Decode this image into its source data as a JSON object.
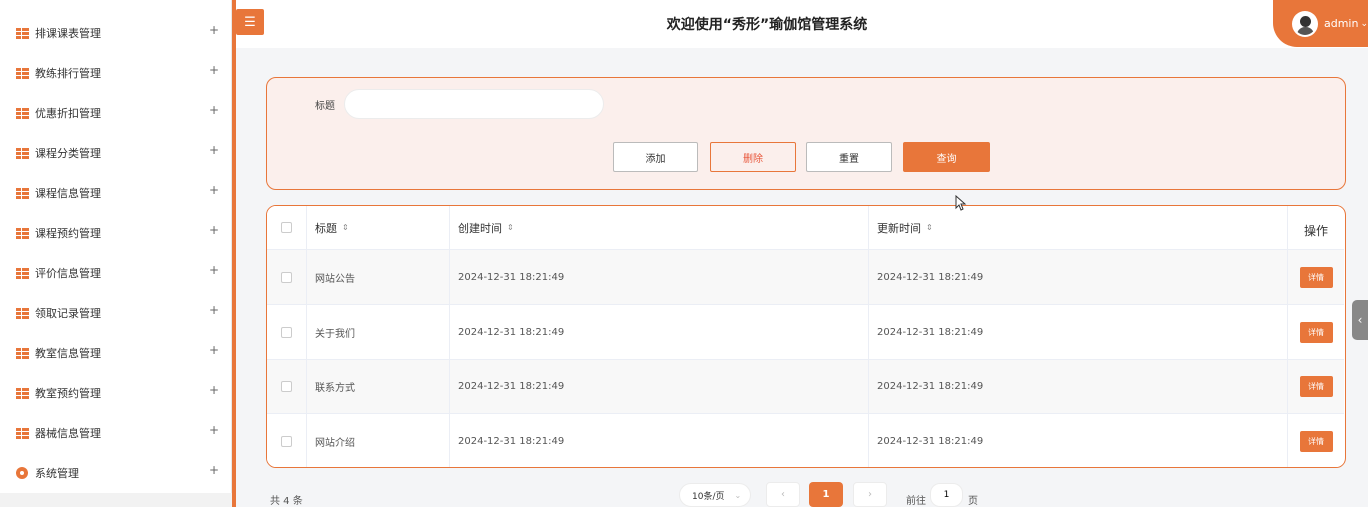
{
  "app": {
    "title": "欢迎使用“秀形”瑜伽馆管理系统",
    "user": "admin"
  },
  "sidebar": {
    "items": [
      {
        "label": "排课课表管理"
      },
      {
        "label": "教练排行管理"
      },
      {
        "label": "优惠折扣管理"
      },
      {
        "label": "课程分类管理"
      },
      {
        "label": "课程信息管理"
      },
      {
        "label": "课程预约管理"
      },
      {
        "label": "评价信息管理"
      },
      {
        "label": "领取记录管理"
      },
      {
        "label": "教室信息管理"
      },
      {
        "label": "教室预约管理"
      },
      {
        "label": "器械信息管理"
      },
      {
        "label": "系统管理"
      }
    ],
    "expand_symbol": "+"
  },
  "search": {
    "label": "标题",
    "value": "",
    "placeholder": ""
  },
  "actions": {
    "add": "添加",
    "delete": "删除",
    "reset": "重置",
    "query": "查询"
  },
  "table": {
    "columns": {
      "title": "标题",
      "created": "创建时间",
      "updated": "更新时间",
      "op": "操作"
    },
    "sort_glyph": "⇕",
    "rows": [
      {
        "title": "网站公告",
        "created": "2024-12-31 18:21:49",
        "updated": "2024-12-31 18:21:49",
        "action": "详情"
      },
      {
        "title": "关于我们",
        "created": "2024-12-31 18:21:49",
        "updated": "2024-12-31 18:21:49",
        "action": "详情"
      },
      {
        "title": "联系方式",
        "created": "2024-12-31 18:21:49",
        "updated": "2024-12-31 18:21:49",
        "action": "详情"
      },
      {
        "title": "网站介绍",
        "created": "2024-12-31 18:21:49",
        "updated": "2024-12-31 18:21:49",
        "action": "详情"
      }
    ]
  },
  "pagination": {
    "total": "共 4 条",
    "page_size": "10条/页",
    "prev": "‹",
    "current": "1",
    "next": "›",
    "goto_prefix": "前往",
    "goto_value": "1",
    "goto_suffix": "页"
  },
  "colors": {
    "accent": "#e8763a",
    "panel_bg": "#fbefec"
  },
  "icons": {
    "menu_toggle": "menu-icon",
    "sidebar_item": "grid-icon",
    "system_item": "gear-icon",
    "side_handle": "chevron-left-icon"
  }
}
